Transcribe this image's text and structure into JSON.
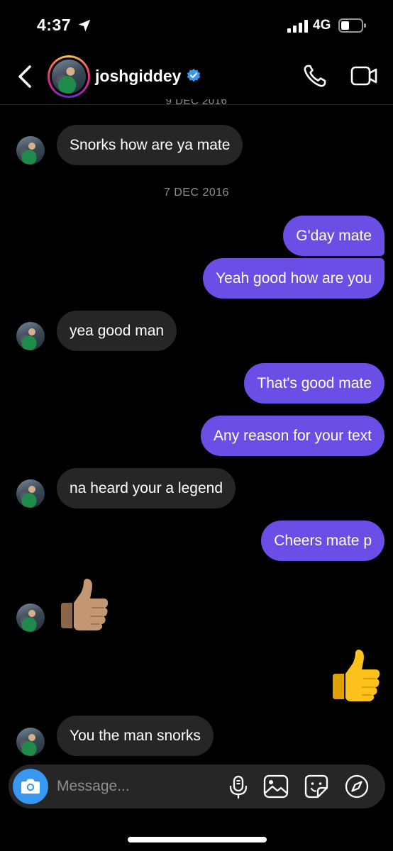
{
  "status_bar": {
    "time": "4:37",
    "network": "4G"
  },
  "header": {
    "username": "joshgiddey"
  },
  "dates": {
    "partial": "9 DEC 2016",
    "sep1": "7 DEC 2016"
  },
  "messages": {
    "m1": "Snorks how are ya mate",
    "m2": "G'day mate",
    "m3": "Yeah good how are you",
    "m4": "yea good man",
    "m5": "That's good mate",
    "m6": "Any reason for your text",
    "m7": "na heard your a legend",
    "m8": "Cheers mate p",
    "m11": "You the man snorks"
  },
  "composer": {
    "placeholder": "Message..."
  },
  "colors": {
    "outgoing": "#6b4ee6",
    "incoming": "#262626",
    "camera": "#3897f0",
    "verified": "#3897f0"
  },
  "icons": {
    "back": "chevron-left-icon",
    "call": "phone-icon",
    "video": "video-camera-icon",
    "camera": "camera-icon",
    "mic": "microphone-icon",
    "gallery": "image-icon",
    "sticker": "sticker-icon",
    "explore": "compass-icon",
    "emoji_incoming": "thumbs-up-medium-skin-icon",
    "emoji_outgoing": "thumbs-up-icon"
  }
}
